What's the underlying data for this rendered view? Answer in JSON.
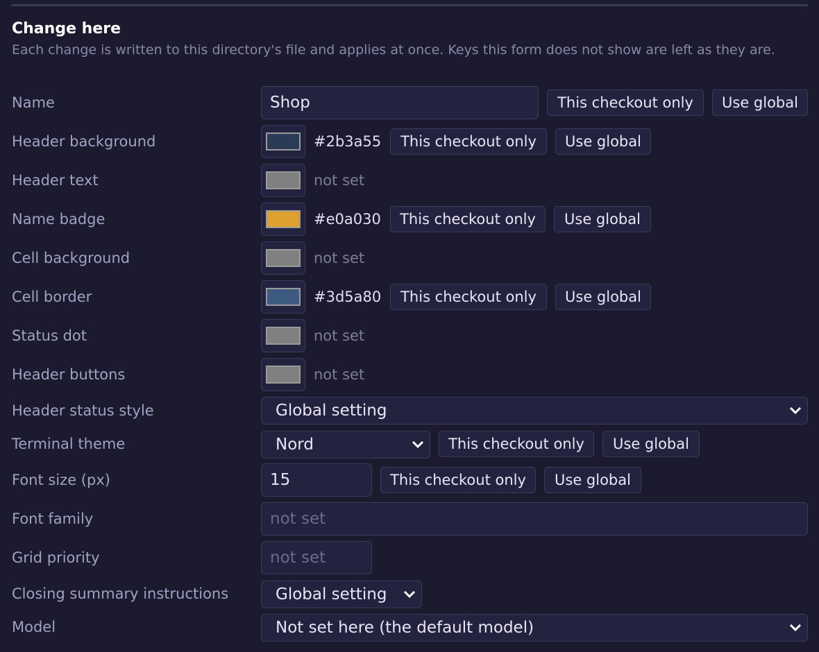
{
  "section": {
    "title": "Change here",
    "description": "Each change is written to this directory's file and applies at once. Keys this form does not show are left as they are."
  },
  "buttons": {
    "this_checkout_only": "This checkout only",
    "use_global": "Use global"
  },
  "fields": {
    "name": {
      "label": "Name",
      "value": "Shop"
    },
    "header_background": {
      "label": "Header background",
      "value": "#2b3a55",
      "color": "#2b3a55"
    },
    "header_text": {
      "label": "Header text",
      "value": "not set",
      "color": "#808080"
    },
    "name_badge": {
      "label": "Name badge",
      "value": "#e0a030",
      "color": "#e0a030"
    },
    "cell_background": {
      "label": "Cell background",
      "value": "not set",
      "color": "#808080"
    },
    "cell_border": {
      "label": "Cell border",
      "value": "#3d5a80",
      "color": "#3d5a80"
    },
    "status_dot": {
      "label": "Status dot",
      "value": "not set",
      "color": "#808080"
    },
    "header_buttons": {
      "label": "Header buttons",
      "value": "not set",
      "color": "#808080"
    },
    "header_status_style": {
      "label": "Header status style",
      "value": "Global setting"
    },
    "terminal_theme": {
      "label": "Terminal theme",
      "value": "Nord"
    },
    "font_size": {
      "label": "Font size (px)",
      "value": "15"
    },
    "font_family": {
      "label": "Font family",
      "placeholder": "not set"
    },
    "grid_priority": {
      "label": "Grid priority",
      "placeholder": "not set"
    },
    "closing_summary": {
      "label": "Closing summary instructions",
      "value": "Global setting"
    },
    "model": {
      "label": "Model",
      "value": "Not set here (the default model)"
    }
  }
}
